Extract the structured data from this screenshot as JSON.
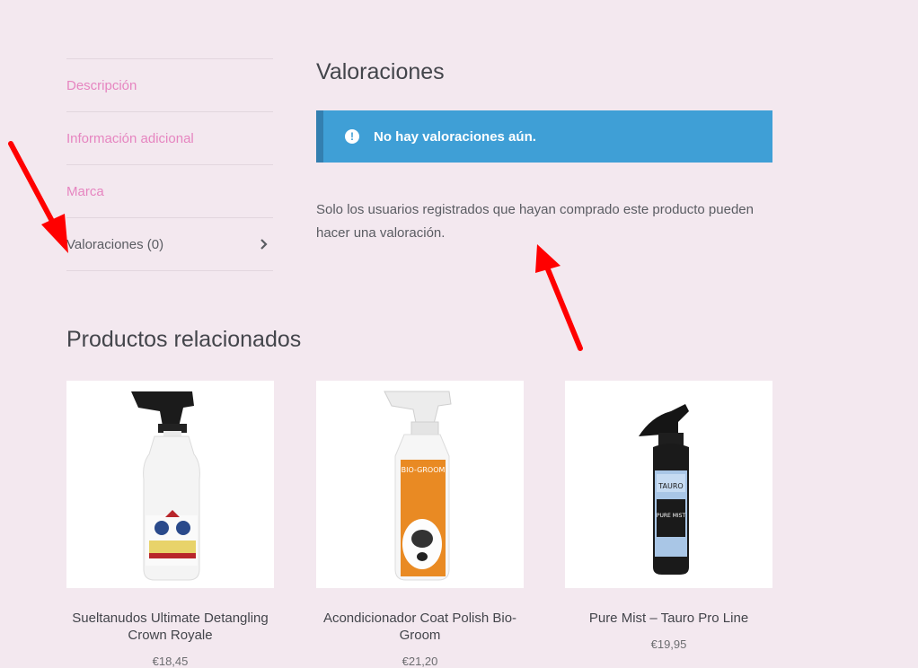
{
  "tabs": [
    {
      "label": "Descripción"
    },
    {
      "label": "Información adicional"
    },
    {
      "label": "Marca"
    },
    {
      "label": "Valoraciones (0)"
    }
  ],
  "reviews": {
    "title": "Valoraciones",
    "notice": "No hay valoraciones aún.",
    "note": "Solo los usuarios registrados que hayan comprado este producto pueden hacer una valoración."
  },
  "related": {
    "title": "Productos relacionados",
    "products": [
      {
        "name": "Sueltanudos Ultimate Detangling Crown Royale",
        "price": "€18,45",
        "image": "white-spray-bottle"
      },
      {
        "name": "Acondicionador Coat Polish Bio-Groom",
        "price": "€21,20",
        "image": "orange-spray-bottle"
      },
      {
        "name": "Pure Mist – Tauro Pro Line",
        "price": "€19,95",
        "image": "black-spray-bottle"
      }
    ]
  },
  "colors": {
    "background": "#f3e8ef",
    "link": "#e685c0",
    "notice": "#3f9fd6",
    "annotation_arrow": "#ff0000"
  }
}
